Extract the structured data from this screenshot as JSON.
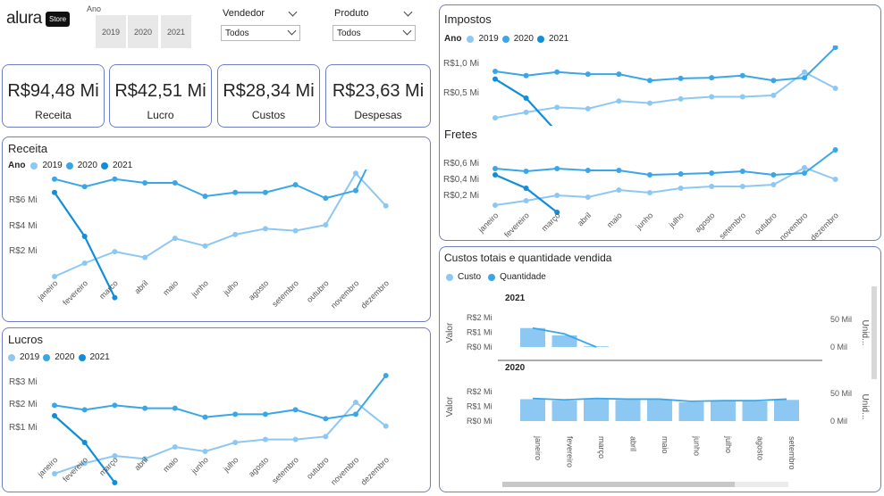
{
  "colors": {
    "c2019": "#8dc8f2",
    "c2020": "#3aa6e8",
    "c2021": "#118ed8",
    "border": "#6f7fc7"
  },
  "logo": {
    "text": "alura",
    "badge": "Store"
  },
  "filters": {
    "year_label": "Ano",
    "years": [
      "2019",
      "2020",
      "2021"
    ],
    "vendor_label": "Vendedor",
    "vendor_value": "Todos",
    "product_label": "Produto",
    "product_value": "Todos"
  },
  "kpis": [
    {
      "value": "R$94,48 Mi",
      "label": "Receita"
    },
    {
      "value": "R$42,51 Mi",
      "label": "Lucro"
    },
    {
      "value": "R$28,34 Mi",
      "label": "Custos"
    },
    {
      "value": "R$23,63 Mi",
      "label": "Despesas"
    }
  ],
  "months": [
    "janeiro",
    "fevereiro",
    "março",
    "abril",
    "maio",
    "junho",
    "julho",
    "agosto",
    "setembro",
    "outubro",
    "novembro",
    "dezembro"
  ],
  "months_receita": [
    "janeiro",
    "fevereiro",
    "marco",
    "abril",
    "maio",
    "junho",
    "julho",
    "agosto",
    "setembro",
    "outubro",
    "novembro",
    "dezembro"
  ],
  "legend_title": "Ano",
  "receita": {
    "title": "Receita",
    "chart_data": {
      "type": "line",
      "yticks": [
        "R$2 Mi",
        "R$4 Mi",
        "R$6 Mi"
      ],
      "ylim": [
        0,
        7
      ],
      "series": [
        {
          "name": "2019",
          "values": [
            1.4,
            2.1,
            2.7,
            2.4,
            3.4,
            3.0,
            3.6,
            3.9,
            3.8,
            4.1,
            6.8,
            5.1
          ]
        },
        {
          "name": "2020",
          "values": [
            6.5,
            6.1,
            6.5,
            6.3,
            6.3,
            5.6,
            5.8,
            5.8,
            6.2,
            5.5,
            5.9,
            9.1
          ]
        },
        {
          "name": "2021",
          "values": [
            5.8,
            3.5,
            0.3
          ]
        }
      ]
    }
  },
  "lucros": {
    "title": "Lucros",
    "chart_data": {
      "type": "line",
      "yticks": [
        "R$1 Mi",
        "R$2 Mi",
        "R$3 Mi"
      ],
      "ylim": [
        0,
        3.6
      ],
      "series": [
        {
          "name": "2019",
          "values": [
            0.3,
            0.65,
            0.9,
            0.8,
            1.2,
            1.05,
            1.35,
            1.45,
            1.45,
            1.55,
            2.7,
            1.9
          ]
        },
        {
          "name": "2020",
          "values": [
            2.6,
            2.45,
            2.6,
            2.5,
            2.5,
            2.2,
            2.3,
            2.3,
            2.45,
            2.15,
            2.3,
            3.6
          ]
        },
        {
          "name": "2021",
          "values": [
            2.25,
            1.35,
            0.0
          ]
        }
      ]
    }
  },
  "impostos": {
    "title": "Impostos",
    "chart_data": {
      "type": "line",
      "yticks": [
        "R$0,5 Mi",
        "R$1,0 Mi"
      ],
      "ylim": [
        0,
        1.1
      ],
      "series": [
        {
          "name": "2019",
          "values": [
            0.2,
            0.28,
            0.35,
            0.33,
            0.44,
            0.41,
            0.47,
            0.5,
            0.5,
            0.52,
            0.85,
            0.62
          ]
        },
        {
          "name": "2020",
          "values": [
            0.86,
            0.8,
            0.85,
            0.82,
            0.82,
            0.73,
            0.76,
            0.77,
            0.8,
            0.73,
            0.77,
            1.2
          ]
        },
        {
          "name": "2021",
          "values": [
            0.75,
            0.48,
            0.0
          ]
        }
      ]
    }
  },
  "fretes": {
    "title": "Fretes",
    "chart_data": {
      "type": "line",
      "yticks": [
        "R$0,2 Mi",
        "R$0,4 Mi",
        "R$0,6 Mi"
      ],
      "ylim": [
        0,
        0.7
      ],
      "series": [
        {
          "name": "2019",
          "values": [
            0.08,
            0.13,
            0.19,
            0.17,
            0.25,
            0.22,
            0.27,
            0.29,
            0.29,
            0.31,
            0.5,
            0.37
          ]
        },
        {
          "name": "2020",
          "values": [
            0.49,
            0.46,
            0.49,
            0.47,
            0.47,
            0.42,
            0.43,
            0.44,
            0.46,
            0.42,
            0.44,
            0.7
          ]
        },
        {
          "name": "2021",
          "values": [
            0.42,
            0.27,
            0.0
          ]
        }
      ]
    }
  },
  "custos": {
    "title": "Custos totais e quantidade vendida",
    "legend": [
      "Custo",
      "Quantidade"
    ],
    "y_axis": "Valor",
    "y2_axis": "Unid...",
    "yticks": [
      "R$0 Mi",
      "R$1 Mi",
      "R$2 Mi"
    ],
    "y2ticks": [
      "0 Mil",
      "50 Mil"
    ],
    "months": [
      "janeiro",
      "fevereiro",
      "março",
      "abril",
      "maio",
      "junho",
      "julho",
      "agosto",
      "setembro"
    ],
    "panels": [
      {
        "year": "2021",
        "chart_data": {
          "type": "bar",
          "categories": [
            "janeiro",
            "fevereiro",
            "março"
          ],
          "values": [
            1.3,
            0.8,
            0.05
          ],
          "line": [
            1.3,
            0.9,
            0.0
          ]
        }
      },
      {
        "year": "2020",
        "chart_data": {
          "type": "bar",
          "categories": [
            "janeiro",
            "fevereiro",
            "março",
            "abril",
            "maio",
            "junho",
            "julho",
            "agosto",
            "setembro"
          ],
          "values": [
            1.5,
            1.4,
            1.5,
            1.45,
            1.45,
            1.3,
            1.35,
            1.35,
            1.45
          ],
          "line": [
            1.55,
            1.45,
            1.55,
            1.5,
            1.5,
            1.35,
            1.4,
            1.4,
            1.5
          ]
        }
      }
    ]
  }
}
